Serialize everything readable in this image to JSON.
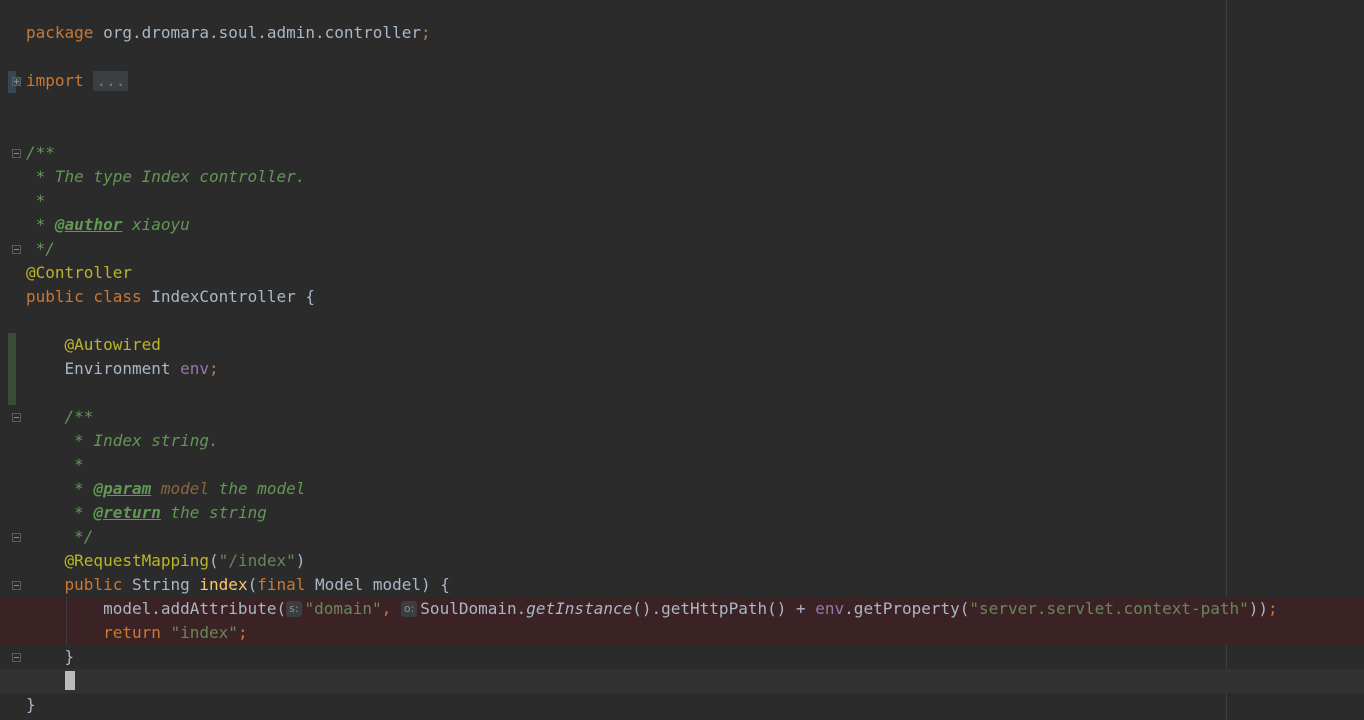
{
  "editor": {
    "lines": [
      [
        {
          "t": "package",
          "c": "kw"
        },
        {
          "t": " org.dromara.soul.admin.controller"
        },
        {
          "t": ";",
          "c": "kw"
        }
      ],
      [],
      [
        {
          "t": "import",
          "c": "kw"
        },
        {
          "t": " "
        },
        {
          "t": "...",
          "c": "fold-box"
        }
      ],
      [],
      [],
      [
        {
          "t": "/**",
          "c": "doc"
        }
      ],
      [
        {
          "t": " * The type Index controller.",
          "c": "doc"
        }
      ],
      [
        {
          "t": " *",
          "c": "doc"
        }
      ],
      [
        {
          "t": " * ",
          "c": "doc"
        },
        {
          "t": "@author",
          "c": "doctag"
        },
        {
          "t": " xiaoyu",
          "c": "doc"
        }
      ],
      [
        {
          "t": " */",
          "c": "doc"
        }
      ],
      [
        {
          "t": "@Controller",
          "c": "ann"
        }
      ],
      [
        {
          "t": "public class ",
          "c": "kw"
        },
        {
          "t": "IndexController {"
        }
      ],
      [],
      [
        {
          "t": "    "
        },
        {
          "t": "@Autowired",
          "c": "ann"
        }
      ],
      [
        {
          "t": "    Environment "
        },
        {
          "t": "env",
          "c": "field"
        },
        {
          "t": ";",
          "c": "kw"
        }
      ],
      [],
      [
        {
          "t": "    "
        },
        {
          "t": "/**",
          "c": "doc"
        }
      ],
      [
        {
          "t": "     * Index string.",
          "c": "doc"
        }
      ],
      [
        {
          "t": "     *",
          "c": "doc"
        }
      ],
      [
        {
          "t": "     * ",
          "c": "doc"
        },
        {
          "t": "@param",
          "c": "doctag"
        },
        {
          "t": " "
        },
        {
          "t": "model",
          "c": "docparam"
        },
        {
          "t": " the model",
          "c": "doc"
        }
      ],
      [
        {
          "t": "     * ",
          "c": "doc"
        },
        {
          "t": "@return",
          "c": "doctag"
        },
        {
          "t": " the string",
          "c": "doc"
        }
      ],
      [
        {
          "t": "     */",
          "c": "doc"
        }
      ],
      [
        {
          "t": "    "
        },
        {
          "t": "@RequestMapping",
          "c": "ann"
        },
        {
          "t": "("
        },
        {
          "t": "\"/index\"",
          "c": "str"
        },
        {
          "t": ")"
        }
      ],
      [
        {
          "t": "    "
        },
        {
          "t": "public ",
          "c": "kw"
        },
        {
          "t": "String "
        },
        {
          "t": "index",
          "c": "method"
        },
        {
          "t": "("
        },
        {
          "t": "final ",
          "c": "kw"
        },
        {
          "t": "Model model) {"
        }
      ],
      [
        {
          "t": "        model.addAttribute("
        },
        {
          "t": "s:",
          "c": "hint"
        },
        {
          "t": "\"domain\"",
          "c": "str"
        },
        {
          "t": ", ",
          "c": "kw"
        },
        {
          "t": "o:",
          "c": "hint"
        },
        {
          "t": "SoulDomain."
        },
        {
          "t": "getInstance",
          "c": "static"
        },
        {
          "t": "().getHttpPath() + "
        },
        {
          "t": "env",
          "c": "field"
        },
        {
          "t": ".getProperty("
        },
        {
          "t": "\"server.servlet.context-path\"",
          "c": "str"
        },
        {
          "t": "))"
        },
        {
          "t": ";",
          "c": "kw"
        }
      ],
      [
        {
          "t": "        "
        },
        {
          "t": "return ",
          "c": "kw"
        },
        {
          "t": "\"index\"",
          "c": "str"
        },
        {
          "t": ";",
          "c": "kw"
        }
      ],
      [
        {
          "t": "    }"
        }
      ],
      [
        {
          "t": "    "
        },
        {
          "t": "",
          "c": "caret"
        }
      ],
      [
        {
          "t": "}"
        }
      ]
    ],
    "error_lines": [
      24,
      25
    ],
    "caret_line": 27
  }
}
